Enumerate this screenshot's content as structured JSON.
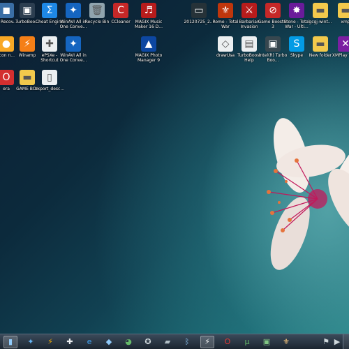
{
  "desktop_icons": [
    {
      "label": "SI Recov...",
      "name": "si-recovery-icon",
      "color": "#3a6ea5",
      "glyph": "◼"
    },
    {
      "label": "TurboBoo...",
      "name": "turboboost-icon",
      "color": "#2c3e50",
      "glyph": "▣"
    },
    {
      "label": "Cheat Engine",
      "name": "cheat-engine-icon",
      "color": "#1e88e5",
      "glyph": "Σ"
    },
    {
      "label": "WinAVI All in One Conve...",
      "name": "winavi-icon",
      "color": "#1565c0",
      "glyph": "✦"
    },
    {
      "label": "Recycle Bin",
      "name": "recycle-bin-icon",
      "color": "#90a4ae",
      "glyph": "🗑"
    },
    {
      "label": "CCleaner",
      "name": "ccleaner-icon",
      "color": "#c62828",
      "glyph": "C"
    },
    {
      "label": "MAGIX Music Maker 16 D...",
      "name": "magix-music-maker-icon",
      "color": "#b71c1c",
      "glyph": "♬"
    },
    {
      "label": "Icon n...",
      "name": "icon-n-icon",
      "color": "#f9a825",
      "glyph": "●"
    },
    {
      "label": "Winamp",
      "name": "winamp-icon",
      "color": "#f57f17",
      "glyph": "⚡"
    },
    {
      "label": "ePSXe - Shortcut",
      "name": "epsxe-icon",
      "color": "#eceff1",
      "glyph": "✚"
    },
    {
      "label": "WinAVI All in One Conve...",
      "name": "winavi-2-icon",
      "color": "#1565c0",
      "glyph": "✦"
    },
    {
      "label": "MAGIX Photo Manager 9",
      "name": "magix-photo-manager-icon",
      "color": "#0d47a1",
      "glyph": "▲"
    },
    {
      "label": "era",
      "name": "opera-icon",
      "color": "#d32f2f",
      "glyph": "O"
    },
    {
      "label": "GAME BOY",
      "name": "game-boy-folder-icon",
      "color": "#f2c94c",
      "glyph": "▬"
    },
    {
      "label": "export_desc...",
      "name": "export-desc-file-icon",
      "color": "#eceff1",
      "glyph": "▯"
    },
    {
      "label": "20120725_2...",
      "name": "screenshot-file-icon",
      "color": "#263238",
      "glyph": "▭"
    },
    {
      "label": "Rome - Total War",
      "name": "rome-total-war-icon",
      "color": "#bf360c",
      "glyph": "⚜"
    },
    {
      "label": "Barbarian Invasion",
      "name": "barbarian-invasion-icon",
      "color": "#b71c1c",
      "glyph": "⚔"
    },
    {
      "label": "Game Booster 3",
      "name": "game-booster-icon",
      "color": "#c62828",
      "glyph": "⊘"
    },
    {
      "label": "Stone - Total War - Ulti...",
      "name": "stone-total-war-icon",
      "color": "#6a1b9a",
      "glyph": "✸"
    },
    {
      "label": "gcgj-wint...",
      "name": "gcgj-folder-icon",
      "color": "#f2c94c",
      "glyph": "▬"
    },
    {
      "label": "xmp",
      "name": "xmp-folder-icon",
      "color": "#f2c94c",
      "glyph": "▬"
    },
    {
      "label": "drawUsa",
      "name": "drawusa-file-icon",
      "color": "#eceff1",
      "glyph": "◇"
    },
    {
      "label": "TurboBoost Help",
      "name": "turboboost-help-icon",
      "color": "#eceff1",
      "glyph": "▤"
    },
    {
      "label": "Intel(R) Turbo Boo...",
      "name": "intel-turbo-boost-icon",
      "color": "#37474f",
      "glyph": "▣"
    },
    {
      "label": "Skype",
      "name": "skype-icon",
      "color": "#039be5",
      "glyph": "S"
    },
    {
      "label": "New folder",
      "name": "new-folder-icon",
      "color": "#f2c94c",
      "glyph": "▬"
    },
    {
      "label": "XMPlay Vis...",
      "name": "xmplay-icon",
      "color": "#7b1fa2",
      "glyph": "✕"
    }
  ],
  "taskbar_items": [
    {
      "name": "file-explorer-taskbar-icon",
      "glyph": "▮",
      "color": "#90caf9",
      "active": true
    },
    {
      "name": "winavi-taskbar-icon",
      "glyph": "✦",
      "color": "#64b5f6",
      "active": false
    },
    {
      "name": "winamp-taskbar-icon",
      "glyph": "⚡",
      "color": "#ffb300",
      "active": false
    },
    {
      "name": "epsxe-taskbar-icon",
      "glyph": "✚",
      "color": "#eceff1",
      "active": false
    },
    {
      "name": "internet-explorer-taskbar-icon",
      "glyph": "e",
      "color": "#42a5f5",
      "active": false
    },
    {
      "name": "diamond-app-taskbar-icon",
      "glyph": "◆",
      "color": "#90caf9",
      "active": false
    },
    {
      "name": "green-app-taskbar-icon",
      "glyph": "◕",
      "color": "#66bb6a",
      "active": false
    },
    {
      "name": "gamepad-taskbar-icon",
      "glyph": "✪",
      "color": "#cfd8dc",
      "active": false
    },
    {
      "name": "controller-taskbar-icon",
      "glyph": "▰",
      "color": "#b0bec5",
      "active": false
    },
    {
      "name": "bluetooth-taskbar-icon",
      "glyph": "ᛒ",
      "color": "#90caf9",
      "active": false
    },
    {
      "name": "flash-app-taskbar-icon",
      "glyph": "⚡",
      "color": "#ffffff",
      "active": true
    },
    {
      "name": "opera-taskbar-icon",
      "glyph": "O",
      "color": "#e53935",
      "active": false
    },
    {
      "name": "torrent-taskbar-icon",
      "glyph": "µ",
      "color": "#66bb6a",
      "active": false
    },
    {
      "name": "game-booster-taskbar-icon",
      "glyph": "▣",
      "color": "#81c784",
      "active": false
    },
    {
      "name": "rome-taskbar-icon",
      "glyph": "⚜",
      "color": "#ffcc80",
      "active": false
    },
    {
      "name": "tray-flag-icon",
      "glyph": "⚑",
      "color": "#cfd8dc",
      "active": false
    },
    {
      "name": "tray-volume-icon",
      "glyph": "▶",
      "color": "#cfd8dc",
      "active": false
    }
  ]
}
